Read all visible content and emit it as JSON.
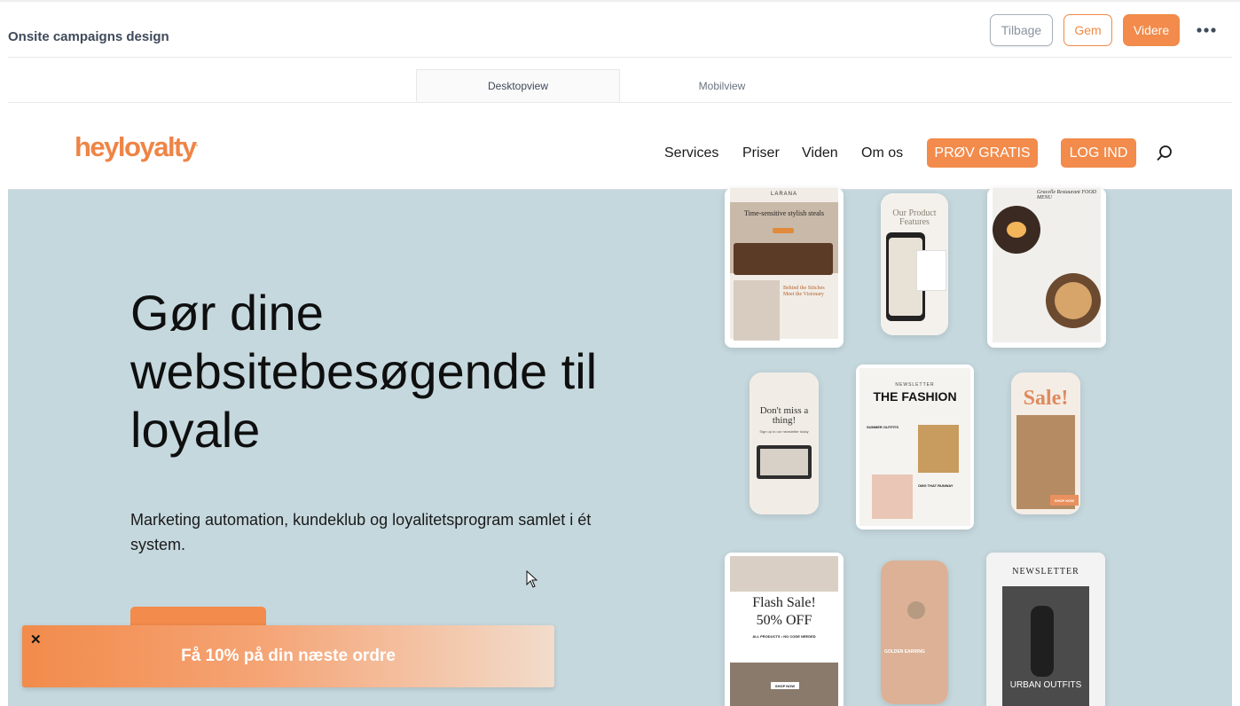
{
  "app": {
    "title": "Onsite campaigns design",
    "back_label": "Tilbage",
    "save_label": "Gem",
    "next_label": "Videre",
    "more_icon": "more-horizontal-icon"
  },
  "view_tabs": {
    "desktop": "Desktopview",
    "mobile": "Mobilview",
    "active": "Desktopview"
  },
  "site": {
    "logo": "heyloyalty",
    "logo_mark": ".",
    "nav": {
      "services": "Services",
      "prices": "Priser",
      "knowledge": "Viden",
      "about": "Om os",
      "try_free": "PRØV GRATIS",
      "login": "LOG IND"
    },
    "hero": {
      "title": "Gør dine websitebesøgende til loyale",
      "subtitle": "Marketing automation, kundeklub og loyalitetsprogram samlet i ét system."
    },
    "templates": {
      "t1_brand": "LARANA",
      "t1_title": "Time-sensitive stylish steals",
      "t1_sub": "Behind the Stitches Meet the Visionary",
      "t2_title": "Our Product Features",
      "t3_title": "Gracelle Restaurant FOOD MENU",
      "t4_title": "Don't miss a thing!",
      "t4_sub": "Sign up to our newsletter today",
      "t5_label": "NEWSLETTER",
      "t5_title": "THE FASHION",
      "t5_sub": "SUMMER OUTFITS",
      "t5_sub2": "OMG THAT RUNWAY",
      "t6_title": "Sale!",
      "t6_cta": "SHOP NOW",
      "t7_title": "Flash Sale!",
      "t7_sub": "50% OFF",
      "t7_small": "ALL PRODUCTS • NO CODE NEEDED",
      "t7_cta": "SHOP NOW",
      "t8_title": "GOLDEN EARRING",
      "t9_label": "NEWSLETTER",
      "t9_title": "URBAN OUTFITS"
    }
  },
  "popup": {
    "text": "Få 10% på din næste ordre",
    "close": "✕"
  },
  "colors": {
    "brand_orange": "#f28b4b",
    "hero_bg": "#c5d8de"
  }
}
